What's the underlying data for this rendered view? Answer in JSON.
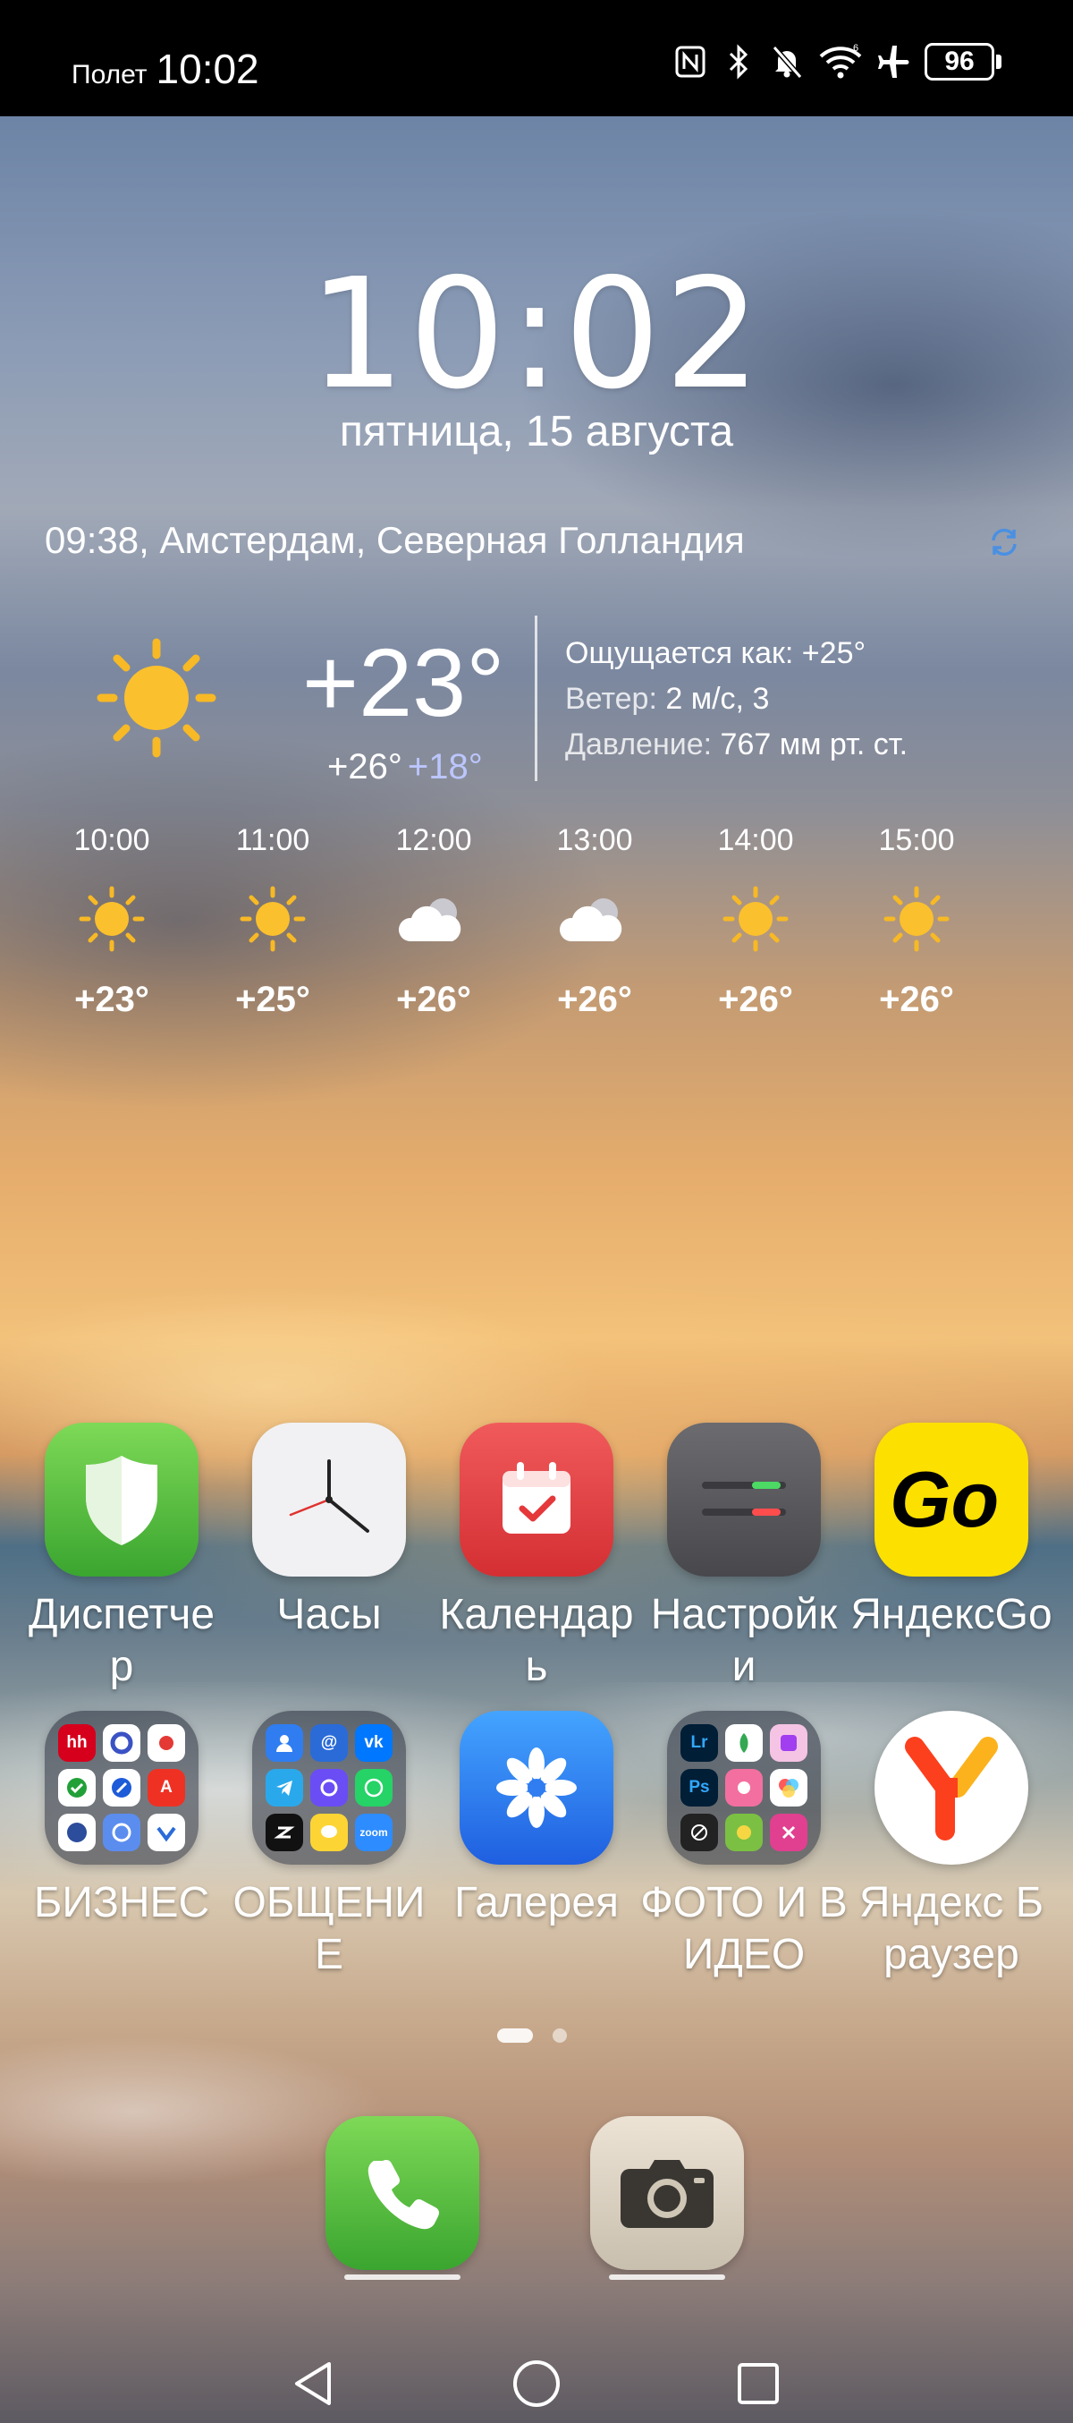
{
  "status_bar": {
    "mode_text": "Полет",
    "time": "10:02",
    "battery_level": "96",
    "icons": [
      "nfc-icon",
      "bluetooth-icon",
      "silent-bell-icon",
      "wifi-icon",
      "airplane-icon",
      "battery-icon"
    ]
  },
  "clock_widget": {
    "time": "10:02",
    "date": "пятница, 15 августа"
  },
  "weather": {
    "updated_location": "09:38, Амстердам, Северная Голландия",
    "current_temp": "+23°",
    "high": "+26°",
    "low": "+18°",
    "feels_like": "Ощущается как: +25°",
    "wind_label": "Ветер:",
    "wind_value": "2 м/с, 3",
    "pressure_label": "Давление:",
    "pressure_value": "767 мм рт. ст.",
    "current_icon": "sun-icon",
    "hourly": [
      {
        "time": "10:00",
        "icon": "sun-icon",
        "temp": "+23°"
      },
      {
        "time": "11:00",
        "icon": "sun-icon",
        "temp": "+25°"
      },
      {
        "time": "12:00",
        "icon": "cloudy-icon",
        "temp": "+26°"
      },
      {
        "time": "13:00",
        "icon": "cloudy-icon",
        "temp": "+26°"
      },
      {
        "time": "14:00",
        "icon": "sun-icon",
        "temp": "+26°"
      },
      {
        "time": "15:00",
        "icon": "sun-icon",
        "temp": "+26°"
      }
    ]
  },
  "apps": [
    {
      "label": "Диспетчер",
      "icon": "shield-icon",
      "color": "#4fbf3d"
    },
    {
      "label": "Часы",
      "icon": "clock-icon",
      "color": "#f0f0f0"
    },
    {
      "label": "Календарь",
      "icon": "calendar-icon",
      "color": "#e5383b"
    },
    {
      "label": "Настройки",
      "icon": "settings-icon",
      "color": "#5a5a5e"
    },
    {
      "label": "ЯндексGo",
      "icon": "yandex-go-icon",
      "color": "#fce000"
    },
    {
      "label": "БИЗНЕС",
      "icon": "folder-icon"
    },
    {
      "label": "ОБЩЕНИЕ",
      "icon": "folder-icon"
    },
    {
      "label": "Галерея",
      "icon": "gallery-flower-icon",
      "color": "#2f7df0"
    },
    {
      "label": "ФОТО И ВИДЕО",
      "icon": "folder-icon"
    },
    {
      "label": "Яндекс Браузер",
      "icon": "yandex-browser-icon",
      "color": "#ffffff"
    }
  ],
  "folders": {
    "business": [
      "hh",
      "",
      "",
      "",
      "",
      "A",
      "",
      "",
      ""
    ],
    "communication": [
      "",
      "@",
      "vk",
      "",
      "",
      "",
      "",
      "",
      "zoom"
    ],
    "photo": [
      "Lr",
      "",
      "",
      "Ps",
      "",
      "",
      "",
      "",
      ""
    ]
  },
  "pager": {
    "pages": 2,
    "active": 1
  },
  "dock": [
    {
      "name": "phone",
      "icon": "phone-icon"
    },
    {
      "name": "camera",
      "icon": "camera-icon"
    }
  ],
  "nav": [
    "back-icon",
    "home-icon",
    "recents-icon"
  ]
}
